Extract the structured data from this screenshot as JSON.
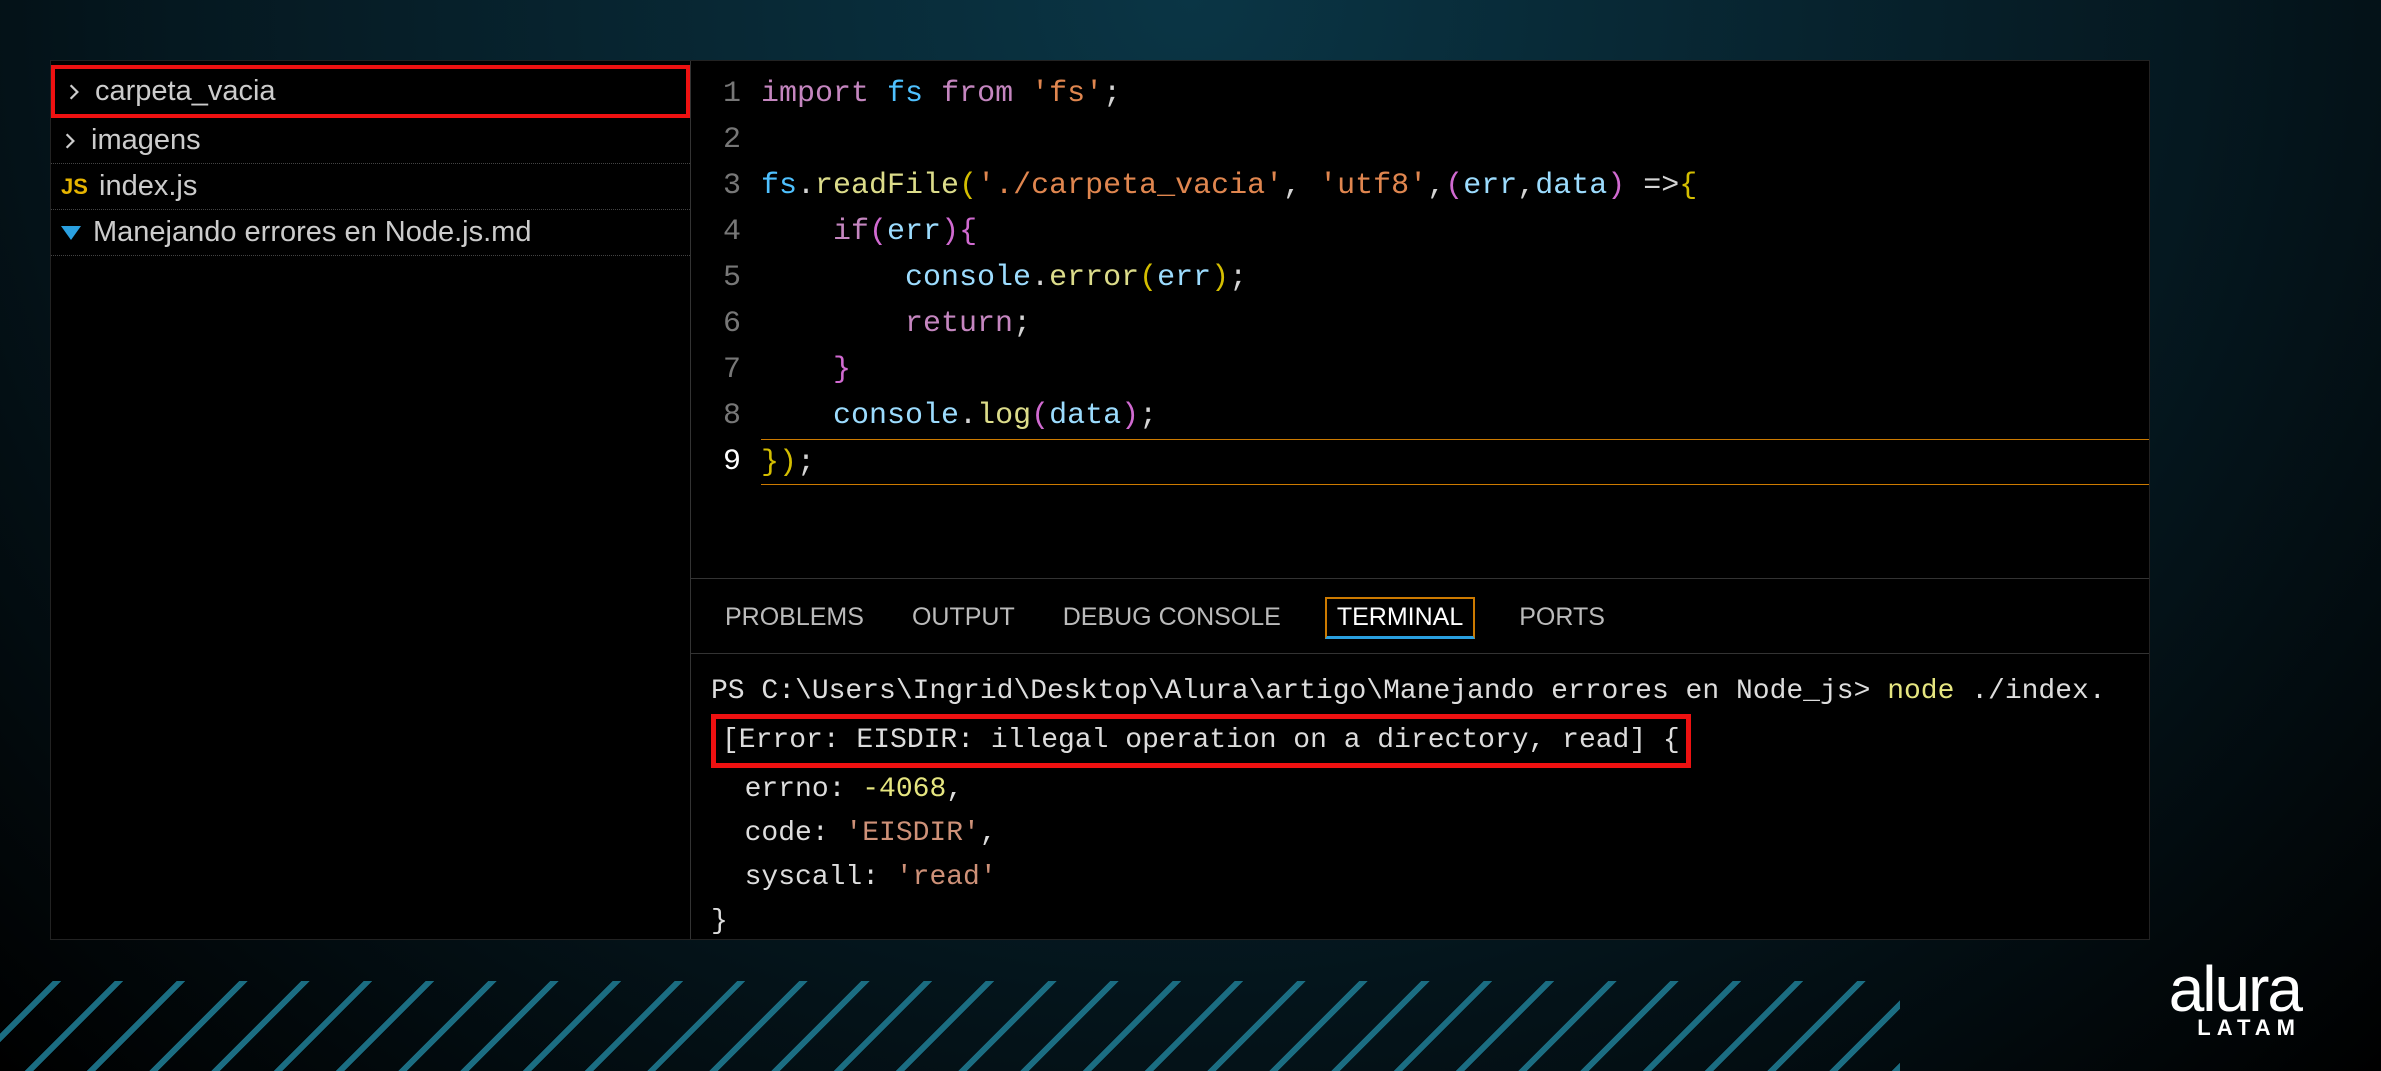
{
  "explorer": {
    "items": [
      {
        "name": "carpeta_vacia",
        "type": "folder",
        "highlighted": true
      },
      {
        "name": "imagens",
        "type": "folder",
        "highlighted": false
      },
      {
        "name": "index.js",
        "type": "js",
        "highlighted": false
      },
      {
        "name": "Manejando errores en Node.js.md",
        "type": "md",
        "highlighted": false
      }
    ]
  },
  "editor": {
    "lines": 9,
    "line1": {
      "kw_import": "import",
      "var": "fs",
      "kw_from": "from",
      "str": "'fs'",
      "semi": ";"
    },
    "line3": {
      "var": "fs",
      "dot": ".",
      "fn": "readFile",
      "lp": "(",
      "str1": "'./carpeta_vacia'",
      "c1": ", ",
      "str2": "'utf8'",
      "c2": ",",
      "lp2": "(",
      "p1": "err",
      "c3": ",",
      "p2": "data",
      "rp2": ")",
      "arrow": " =>",
      "lb": "{"
    },
    "line4": {
      "kw": "if",
      "lp": "(",
      "p": "err",
      "rp": ")",
      "lb": "{"
    },
    "line5": {
      "obj": "console",
      "dot": ".",
      "fn": "error",
      "lp": "(",
      "p": "err",
      "rp": ")",
      "semi": ";"
    },
    "line6": {
      "kw": "return",
      "semi": ";"
    },
    "line7": {
      "rb": "}"
    },
    "line8": {
      "obj": "console",
      "dot": ".",
      "fn": "log",
      "lp": "(",
      "p": "data",
      "rp": ")",
      "semi": ";"
    },
    "line9": {
      "rb": "}",
      "rp": ")",
      "semi": ";"
    }
  },
  "panel": {
    "tabs": [
      "PROBLEMS",
      "OUTPUT",
      "DEBUG CONSOLE",
      "TERMINAL",
      "PORTS"
    ],
    "active_tab": "TERMINAL",
    "terminal": {
      "line1_pre": "PS C:\\Users\\Ingrid\\Desktop\\Alura\\artigo\\Manejando errores en Node_js> ",
      "line1_cmd": "node ",
      "line1_arg": "./index.",
      "line2": "[Error: EISDIR: illegal operation on a directory, read] {",
      "line3_lbl": "  errno: ",
      "line3_val": "-4068",
      "line3_c": ",",
      "line4_lbl": "  code: ",
      "line4_val": "'EISDIR'",
      "line4_c": ",",
      "line5_lbl": "  syscall: ",
      "line5_val": "'read'",
      "line6": "}"
    }
  },
  "branding": {
    "name": "alura",
    "region": "LATAM"
  }
}
